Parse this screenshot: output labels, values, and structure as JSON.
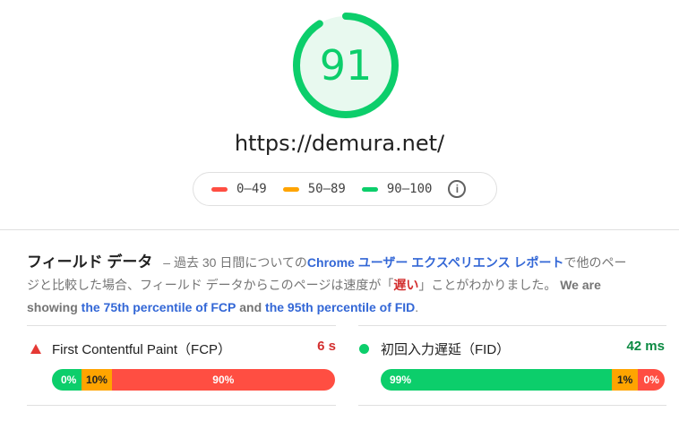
{
  "score": {
    "value": "91",
    "fraction": 0.91,
    "color": "#0cce6b",
    "bg": "#e8f9ef"
  },
  "url": "https://demura.net/",
  "legend": [
    {
      "label": "0–49",
      "color": "#ff4e42"
    },
    {
      "label": "50–89",
      "color": "#ffa400"
    },
    {
      "label": "90–100",
      "color": "#0cce6b"
    }
  ],
  "legend_info_icon": "info-icon",
  "field_data": {
    "title": "フィールド データ",
    "dash": "–",
    "t1": "過去 30 日間についての",
    "link_chrome": "Chrome ユーザー エクスペリエンス レポート",
    "t2": "で他のページと比較した場合、フィールド データからこのページは速度が「",
    "slow": "遅い",
    "t3": "」ことがわかりました。",
    "t4": "We are showing",
    "link_fcp": "the 75th percentile of FCP",
    "t5": "and",
    "link_fid": "the 95th percentile of FID",
    "t6": "."
  },
  "metrics": [
    {
      "name": "First Contentful Paint（FCP）",
      "value": "6 s",
      "value_color": "#d32f2f",
      "status_icon": "triangle-warning-icon",
      "distribution": [
        {
          "label": "0%",
          "fraction": 0.0,
          "color": "#0cce6b"
        },
        {
          "label": "10%",
          "fraction": 0.1,
          "color": "#ffa400"
        },
        {
          "label": "90%",
          "fraction": 0.9,
          "color": "#ff4e42"
        }
      ]
    },
    {
      "name": "初回入力遅延（FID）",
      "value": "42 ms",
      "value_color": "#0b8a42",
      "status_icon": "circle-pass-icon",
      "distribution": [
        {
          "label": "99%",
          "fraction": 0.99,
          "color": "#0cce6b"
        },
        {
          "label": "1%",
          "fraction": 0.01,
          "color": "#ffa400"
        },
        {
          "label": "0%",
          "fraction": 0.0,
          "color": "#ff4e42"
        }
      ]
    }
  ]
}
